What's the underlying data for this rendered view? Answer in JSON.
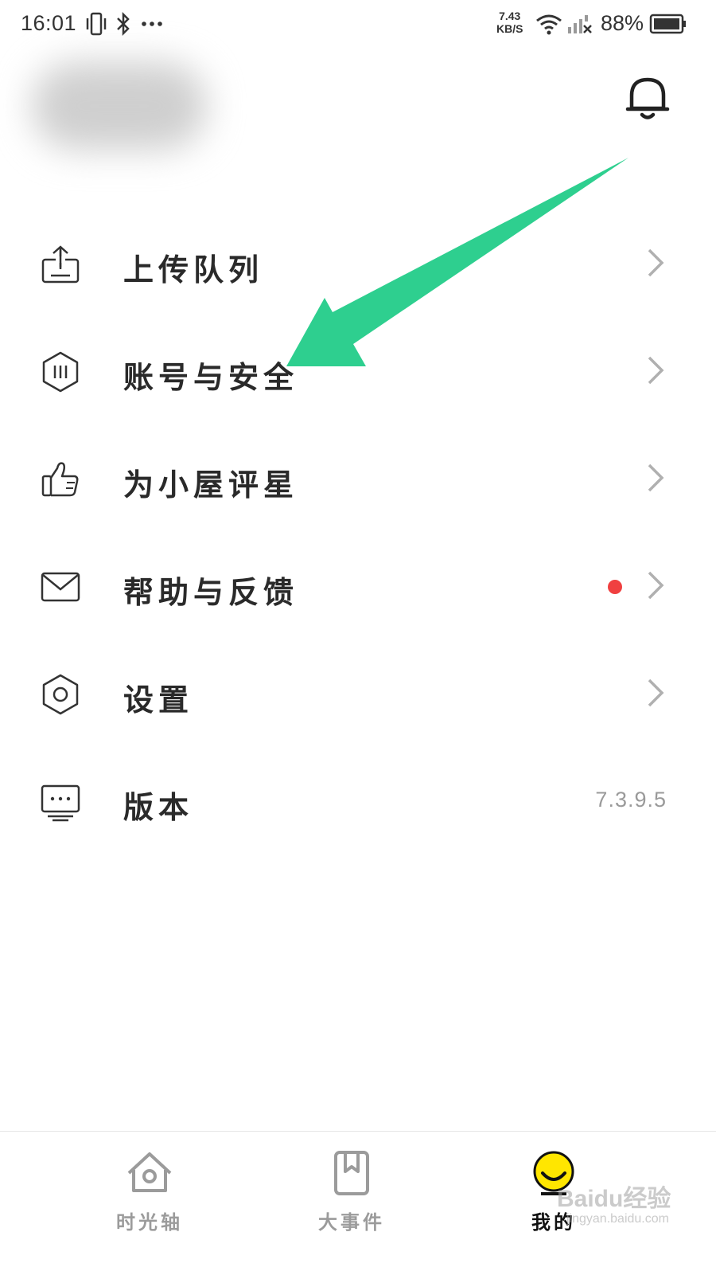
{
  "status_bar": {
    "time": "16:01",
    "net_speed_value": "7.43",
    "net_speed_unit": "KB/S",
    "battery": "88%",
    "icons": [
      "vibrate-icon",
      "bluetooth-icon",
      "more-dots-icon",
      "wifi-icon",
      "signal-icon",
      "battery-icon"
    ]
  },
  "header": {
    "notification_icon": "bell-icon"
  },
  "menu": {
    "items": [
      {
        "label": "上传队列",
        "icon": "upload-icon"
      },
      {
        "label": "账号与安全",
        "icon": "shield-icon"
      },
      {
        "label": "为小屋评星",
        "icon": "thumbs-up-icon"
      },
      {
        "label": "帮助与反馈",
        "icon": "mail-icon",
        "badge": "red-dot"
      },
      {
        "label": "设置",
        "icon": "settings-icon"
      },
      {
        "label": "版本",
        "icon": "monitor-icon",
        "value": "7.3.9.5"
      }
    ]
  },
  "annotation": {
    "arrow_color": "#2ecf8f"
  },
  "tabbar": {
    "tabs": [
      {
        "label": "时光轴",
        "icon": "home-icon",
        "active": false
      },
      {
        "label": "大事件",
        "icon": "bookmark-icon",
        "active": false
      },
      {
        "label": "我的",
        "icon": "smiley-icon",
        "active": true
      }
    ]
  },
  "watermark": {
    "text": "Baidu经验",
    "sub": "jingyan.baidu.com"
  },
  "colors": {
    "badge_red": "#f04040",
    "active_yellow": "#ffe600",
    "inactive_gray": "#9b9b9b",
    "chevron_gray": "#b0b0b0"
  }
}
